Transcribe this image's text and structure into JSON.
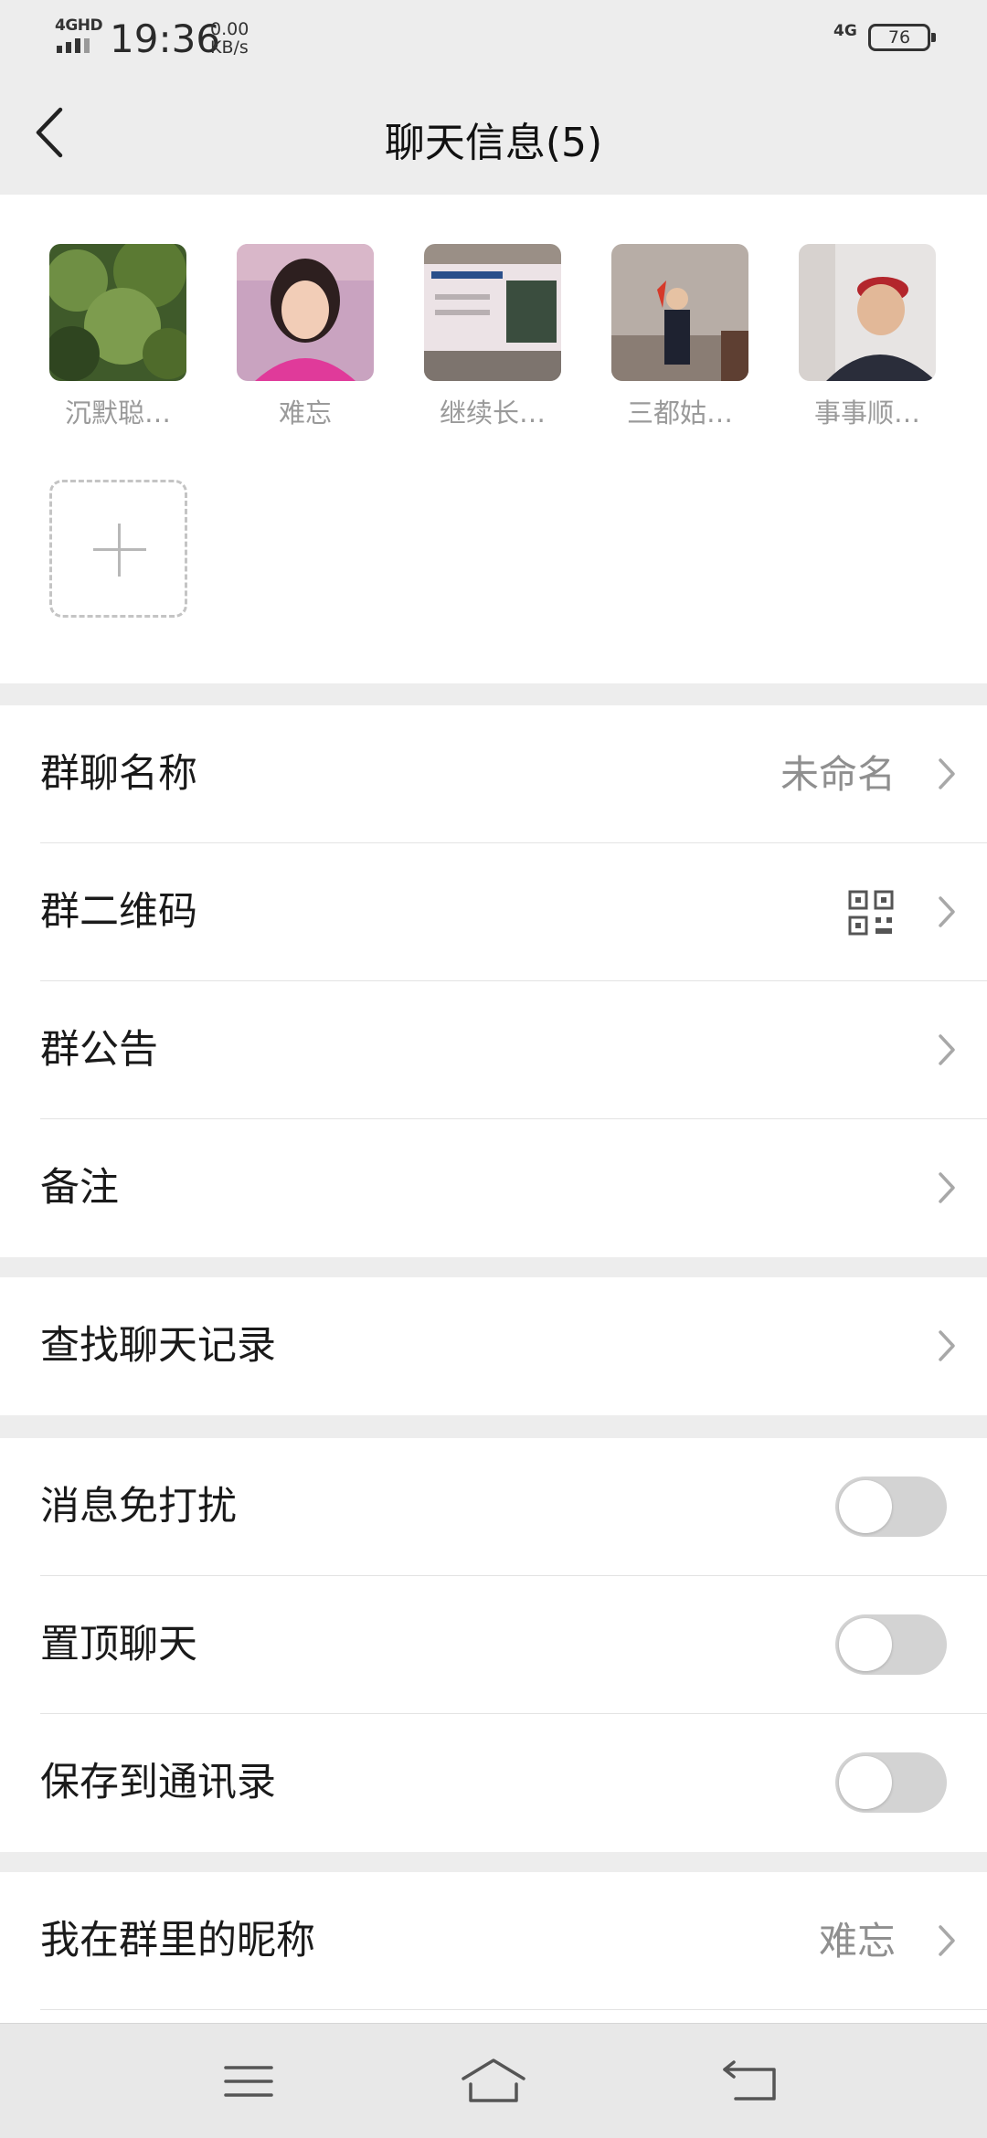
{
  "status_bar": {
    "network_left": "4GHD",
    "time": "19:36",
    "speed_value": "0.00",
    "speed_unit": "KB/s",
    "network_right": "4G",
    "battery": "76"
  },
  "header": {
    "title": "聊天信息(5)",
    "back_icon": "chevron-left-icon"
  },
  "members": [
    {
      "name": "沉默聪…"
    },
    {
      "name": "难忘"
    },
    {
      "name": "继续长…"
    },
    {
      "name": "三都姑…"
    },
    {
      "name": "事事顺…"
    }
  ],
  "add_member_icon": "plus-icon",
  "group_section": {
    "name_label": "群聊名称",
    "name_value": "未命名",
    "qr_label": "群二维码",
    "announcement_label": "群公告",
    "remark_label": "备注"
  },
  "search_section": {
    "label": "查找聊天记录"
  },
  "toggle_section": {
    "mute_label": "消息免打扰",
    "mute_on": false,
    "pin_label": "置顶聊天",
    "pin_on": false,
    "save_label": "保存到通讯录",
    "save_on": false
  },
  "nickname_section": {
    "label": "我在群里的昵称",
    "value": "难忘"
  },
  "colors": {
    "page_bg": "#ededed",
    "card_bg": "#ffffff",
    "toggle_off": "#d3d3d3",
    "secondary_text": "#8f8f8f"
  },
  "nav_bar": {
    "icons": [
      "menu-icon",
      "home-icon",
      "back-icon"
    ]
  }
}
